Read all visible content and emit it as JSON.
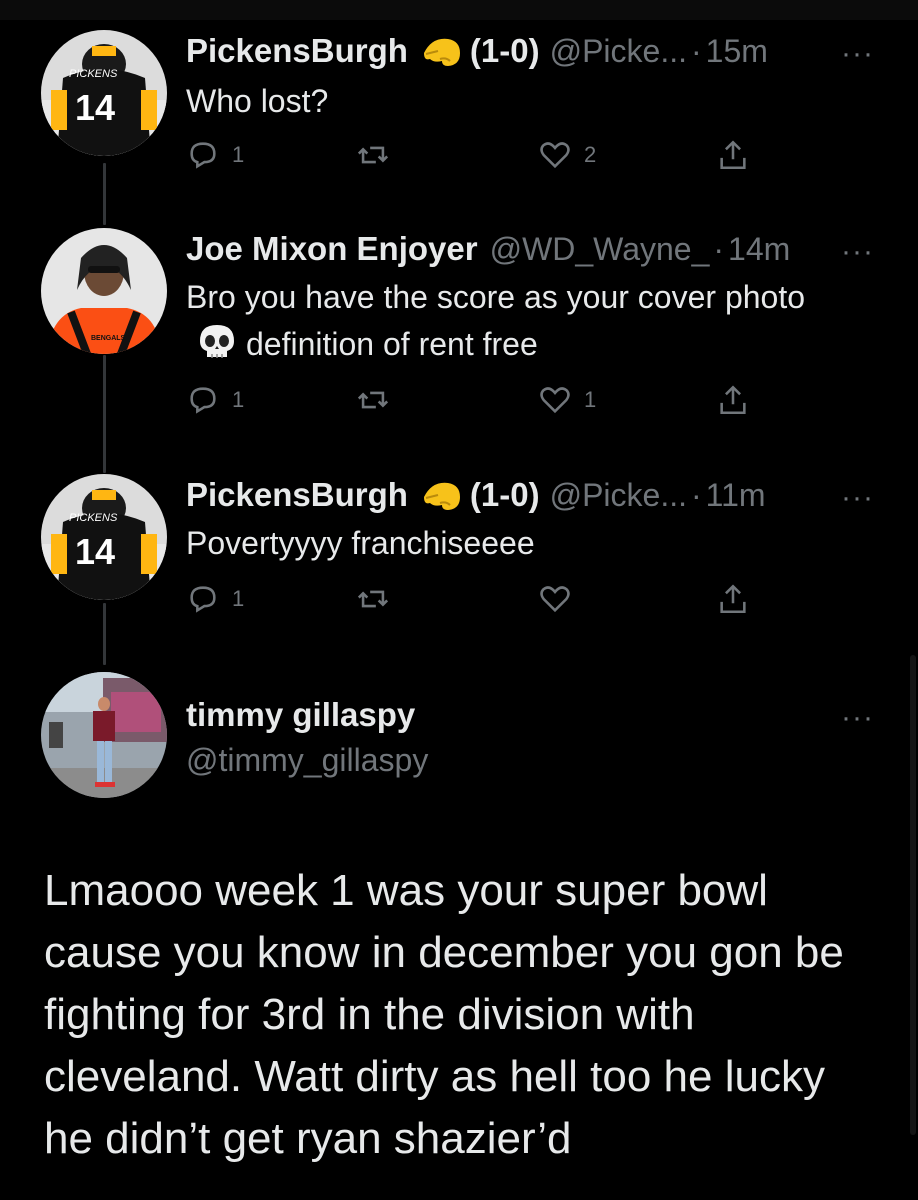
{
  "tweets": [
    {
      "name": "PickensBurgh",
      "record": "(1-0)",
      "handle": "@Picke...",
      "dot": "·",
      "time": "15m",
      "more": "···",
      "text": "Who lost?",
      "replies": "1",
      "retweets": "",
      "likes": "2",
      "avatar_label": "PICKENS",
      "avatar_number": "14"
    },
    {
      "name": "Joe Mixon Enjoyer",
      "handle": "@WD_Wayne_",
      "dot": "·",
      "time": "14m",
      "more": "···",
      "text_part1": "Bro you have the score as your cover photo",
      "text_part2": "definition of rent free",
      "replies": "1",
      "retweets": "",
      "likes": "1",
      "avatar_label": "BENGALS"
    },
    {
      "name": "PickensBurgh",
      "record": "(1-0)",
      "handle": "@Picke...",
      "dot": "·",
      "time": "11m",
      "more": "···",
      "text": "Povertyyyy franchiseeee",
      "replies": "1",
      "retweets": "",
      "likes": "",
      "avatar_label": "PICKENS",
      "avatar_number": "14"
    }
  ],
  "main_tweet": {
    "name": "timmy gillaspy",
    "handle": "@timmy_gillaspy",
    "more": "···",
    "text": "Lmaooo week 1 was your super bowl cause you know in december you gon be fighting for 3rd in the division with cleveland. Watt dirty as hell too he lucky he didn’t get ryan shazier’d"
  },
  "icons": [
    "reply-icon",
    "retweet-icon",
    "like-icon",
    "share-icon",
    "pinching-hand-emoji",
    "skull-emoji",
    "more-icon"
  ],
  "colors": {
    "background": "#000000",
    "text": "#e7e9ea",
    "secondary": "#71767b",
    "thread_line": "#333639",
    "steelers_gold": "#ffb612",
    "bengals_orange": "#fb4f14"
  }
}
